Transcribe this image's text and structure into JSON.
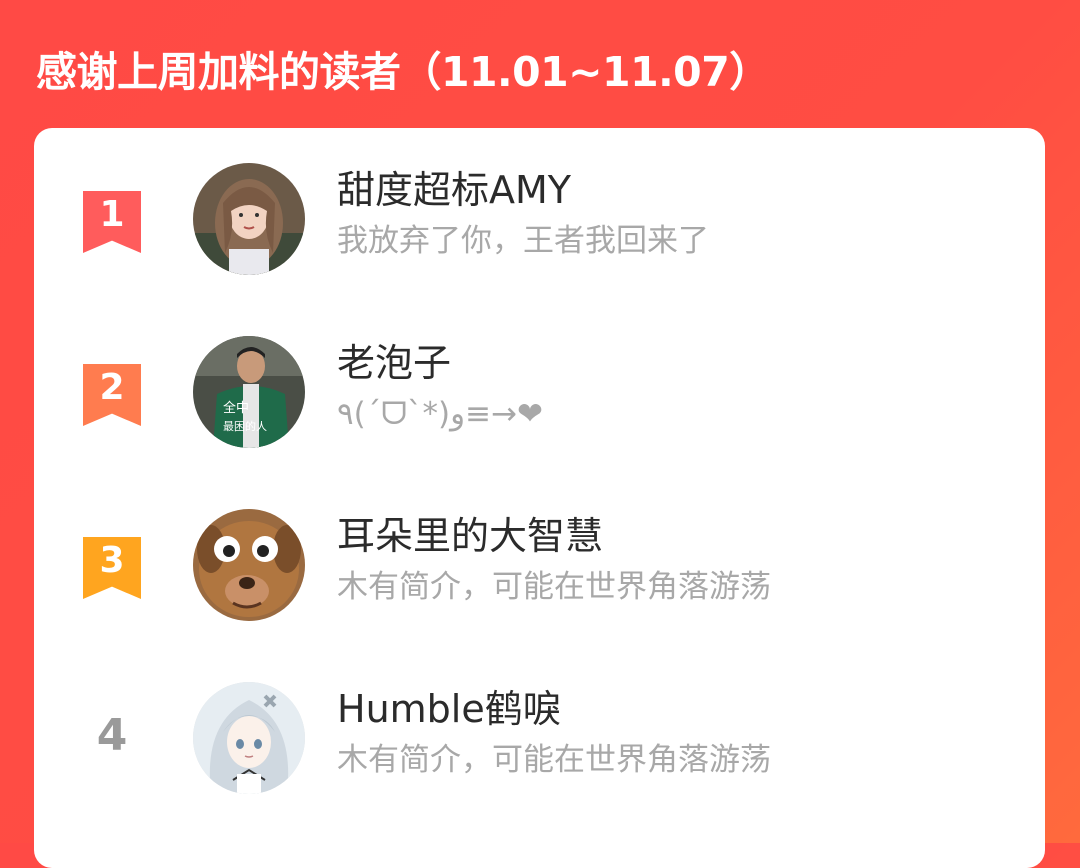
{
  "header": {
    "title": "感谢上周加料的读者（11.01~11.07）"
  },
  "colors": {
    "background_red": "#ff4a45",
    "rank_1": "#ff5c5c",
    "rank_2": "#ff7c4f",
    "rank_3": "#ffa51f",
    "rank_plain": "#9a9a9a"
  },
  "readers": [
    {
      "rank": "1",
      "name": "甜度超标AMY",
      "bio": "我放弃了你，王者我回来了",
      "avatar_icon": "girl-portrait-avatar"
    },
    {
      "rank": "2",
      "name": "老泡子",
      "bio": "٩(ˊᗜˋ*)و≡→❤",
      "avatar_icon": "man-green-jacket-avatar",
      "avatar_caption": [
        "全中",
        "最困的人"
      ]
    },
    {
      "rank": "3",
      "name": "耳朵里的大智慧",
      "bio": "木有简介，可能在世界角落游荡",
      "avatar_icon": "dog-face-avatar"
    },
    {
      "rank": "4",
      "name": "Humble鹤唳",
      "bio": "木有简介，可能在世界角落游荡",
      "avatar_icon": "anime-girl-avatar"
    }
  ]
}
